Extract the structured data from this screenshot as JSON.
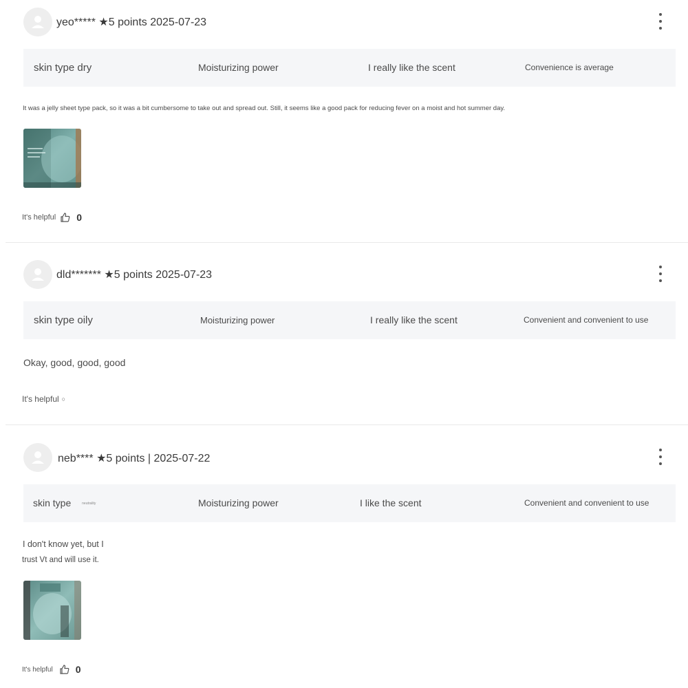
{
  "reviews": [
    {
      "user": "yeo*****",
      "rating": "★5 points",
      "date": "2025-07-23",
      "separator": "",
      "attributes": {
        "skin_type": "skin type dry",
        "moisture": "Moisturizing power",
        "scent": "I really like the scent",
        "convenience": "Convenience is average"
      },
      "text": "It was a jelly sheet type pack, so it was a bit cumbersome to take out and spread out. Still, it seems like a good pack for reducing fever on a moist and hot summer day.",
      "helpful_label": "It's helpful",
      "helpful_count": "0",
      "photo_icon": "sheet-mask-package-photo"
    },
    {
      "user": "dld*******",
      "rating": "★5 points",
      "date": "2025-07-23",
      "attributes": {
        "skin_type": "skin type oily",
        "moisture": "Moisturizing power",
        "scent": "I really like the scent",
        "convenience": "Convenient and convenient to use"
      },
      "text": "Okay, good, good, good",
      "helpful_label": "It's helpful",
      "helpful_marker": "○"
    },
    {
      "user": "neb****",
      "rating": "★5 points",
      "separator": "|",
      "date": "2025-07-22",
      "attributes": {
        "skin_type": "skin type",
        "skin_type_value": "neutrality",
        "moisture": "Moisturizing power",
        "scent": "I like the scent",
        "convenience": "Convenient and convenient to use"
      },
      "text_line1": "I don't know yet, but I",
      "text_line2": "trust Vt and will use it.",
      "helpful_label": "It's helpful",
      "helpful_count": "0",
      "photo_icon": "sheet-mask-package-photo"
    }
  ],
  "icons": {
    "avatar": "user-avatar-icon",
    "more": "more-vertical-icon",
    "thumb": "thumbs-up-icon"
  },
  "colors": {
    "background": "#ffffff",
    "attribute_bar": "#f5f6f8",
    "divider": "#e9e9e9",
    "text": "#4a4a4a"
  }
}
